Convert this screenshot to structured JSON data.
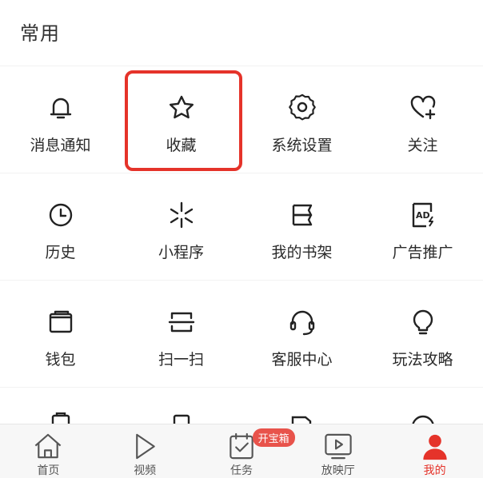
{
  "section": {
    "title": "常用"
  },
  "grid": {
    "rows": [
      [
        {
          "label": "消息通知",
          "icon": "bell-icon"
        },
        {
          "label": "收藏",
          "icon": "star-icon"
        },
        {
          "label": "系统设置",
          "icon": "gear-icon"
        },
        {
          "label": "关注",
          "icon": "heart-plus-icon"
        }
      ],
      [
        {
          "label": "历史",
          "icon": "clock-icon"
        },
        {
          "label": "小程序",
          "icon": "mini-program-icon"
        },
        {
          "label": "我的书架",
          "icon": "bookshelf-icon"
        },
        {
          "label": "广告推广",
          "icon": "ad-icon"
        }
      ],
      [
        {
          "label": "钱包",
          "icon": "wallet-icon"
        },
        {
          "label": "扫一扫",
          "icon": "scan-icon"
        },
        {
          "label": "客服中心",
          "icon": "headset-icon"
        },
        {
          "label": "玩法攻略",
          "icon": "lightbulb-icon"
        }
      ]
    ]
  },
  "highlight": {
    "target": "收藏",
    "color": "#e5332a"
  },
  "tabbar": {
    "items": [
      {
        "label": "首页",
        "icon": "home-icon"
      },
      {
        "label": "视频",
        "icon": "play-icon"
      },
      {
        "label": "任务",
        "icon": "task-icon",
        "badge": "开宝箱"
      },
      {
        "label": "放映厅",
        "icon": "tv-play-icon"
      },
      {
        "label": "我的",
        "icon": "user-icon",
        "active": true
      }
    ],
    "active_color": "#e5332a"
  }
}
